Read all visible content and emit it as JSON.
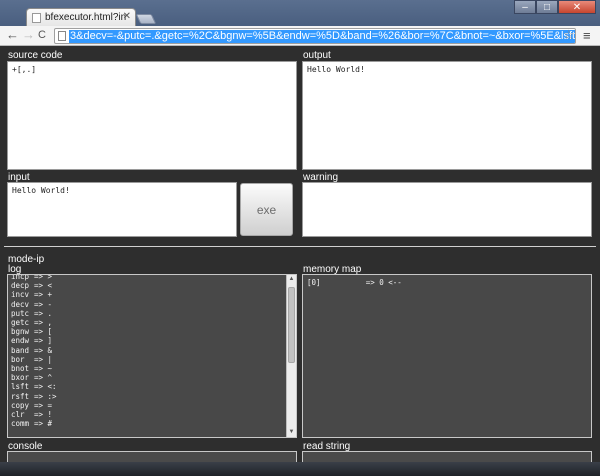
{
  "browser": {
    "tab_title": "bfexecutor.html?in",
    "url": "3&decv=-&putc=.&getc=%2C&bgnw=%5B&endw=%5D&band=%26&bor=%7C&bnot=~&bxor=%5E&lsft=<%3A",
    "back_glyph": "←",
    "forward_glyph": "→",
    "reload_glyph": "C",
    "star_glyph": "☆",
    "menu_glyph": "≡",
    "min_glyph": "–",
    "max_glyph": "□",
    "close_glyph": "✕"
  },
  "source": {
    "label": "source code",
    "code": "+[,.]"
  },
  "output": {
    "label": "output",
    "text": "Hello World!"
  },
  "input": {
    "label": "input",
    "text": "Hello World!"
  },
  "exe": {
    "label": "exe"
  },
  "warning": {
    "label": "warning",
    "text": ""
  },
  "mode": {
    "label": "mode-ip"
  },
  "log": {
    "label": "log",
    "rows": [
      {
        "k": "incp",
        "v": "=> >"
      },
      {
        "k": "decp",
        "v": "=> <"
      },
      {
        "k": "incv",
        "v": "=> +"
      },
      {
        "k": "decv",
        "v": "=> -"
      },
      {
        "k": "putc",
        "v": "=> ."
      },
      {
        "k": "getc",
        "v": "=> ,"
      },
      {
        "k": "bgnw",
        "v": "=> ["
      },
      {
        "k": "endw",
        "v": "=> ]"
      },
      {
        "k": "band",
        "v": "=> &"
      },
      {
        "k": "bor",
        "v": "=> |"
      },
      {
        "k": "bnot",
        "v": "=> ~"
      },
      {
        "k": "bxor",
        "v": "=> ^"
      },
      {
        "k": "lsft",
        "v": "=> <:"
      },
      {
        "k": "rsft",
        "v": "=> :>"
      },
      {
        "k": "copy",
        "v": "=> ="
      },
      {
        "k": "clr",
        "v": "=> !"
      },
      {
        "k": "comm",
        "v": "=> #"
      }
    ]
  },
  "memory": {
    "label": "memory map",
    "line": "[0]          => 0 <--"
  },
  "console": {
    "label": "console",
    "value": ""
  },
  "readstring": {
    "label": "read string",
    "value": ""
  }
}
